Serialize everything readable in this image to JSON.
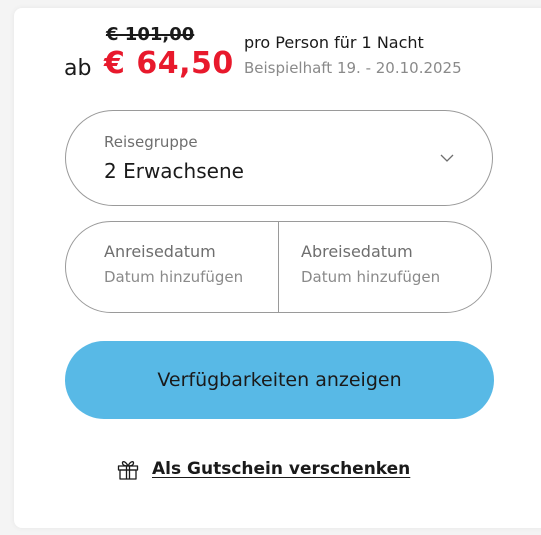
{
  "pricing": {
    "old_price": "€ 101,00",
    "prefix": "ab",
    "new_price": "€ 64,50",
    "per_person": "pro Person für 1 Nacht",
    "example": "Beispielhaft 19. - 20.10.2025"
  },
  "group": {
    "label": "Reisegruppe",
    "value": "2 Erwachsene"
  },
  "dates": {
    "arrival_label": "Anreisedatum",
    "arrival_placeholder": "Datum hinzufügen",
    "departure_label": "Abreisedatum",
    "departure_placeholder": "Datum hinzufügen"
  },
  "cta": {
    "label": "Verfügbarkeiten anzeigen"
  },
  "gift": {
    "label": "Als Gutschein verschenken"
  },
  "colors": {
    "price_red": "#e8192c",
    "cta_blue": "#58b9e6"
  }
}
